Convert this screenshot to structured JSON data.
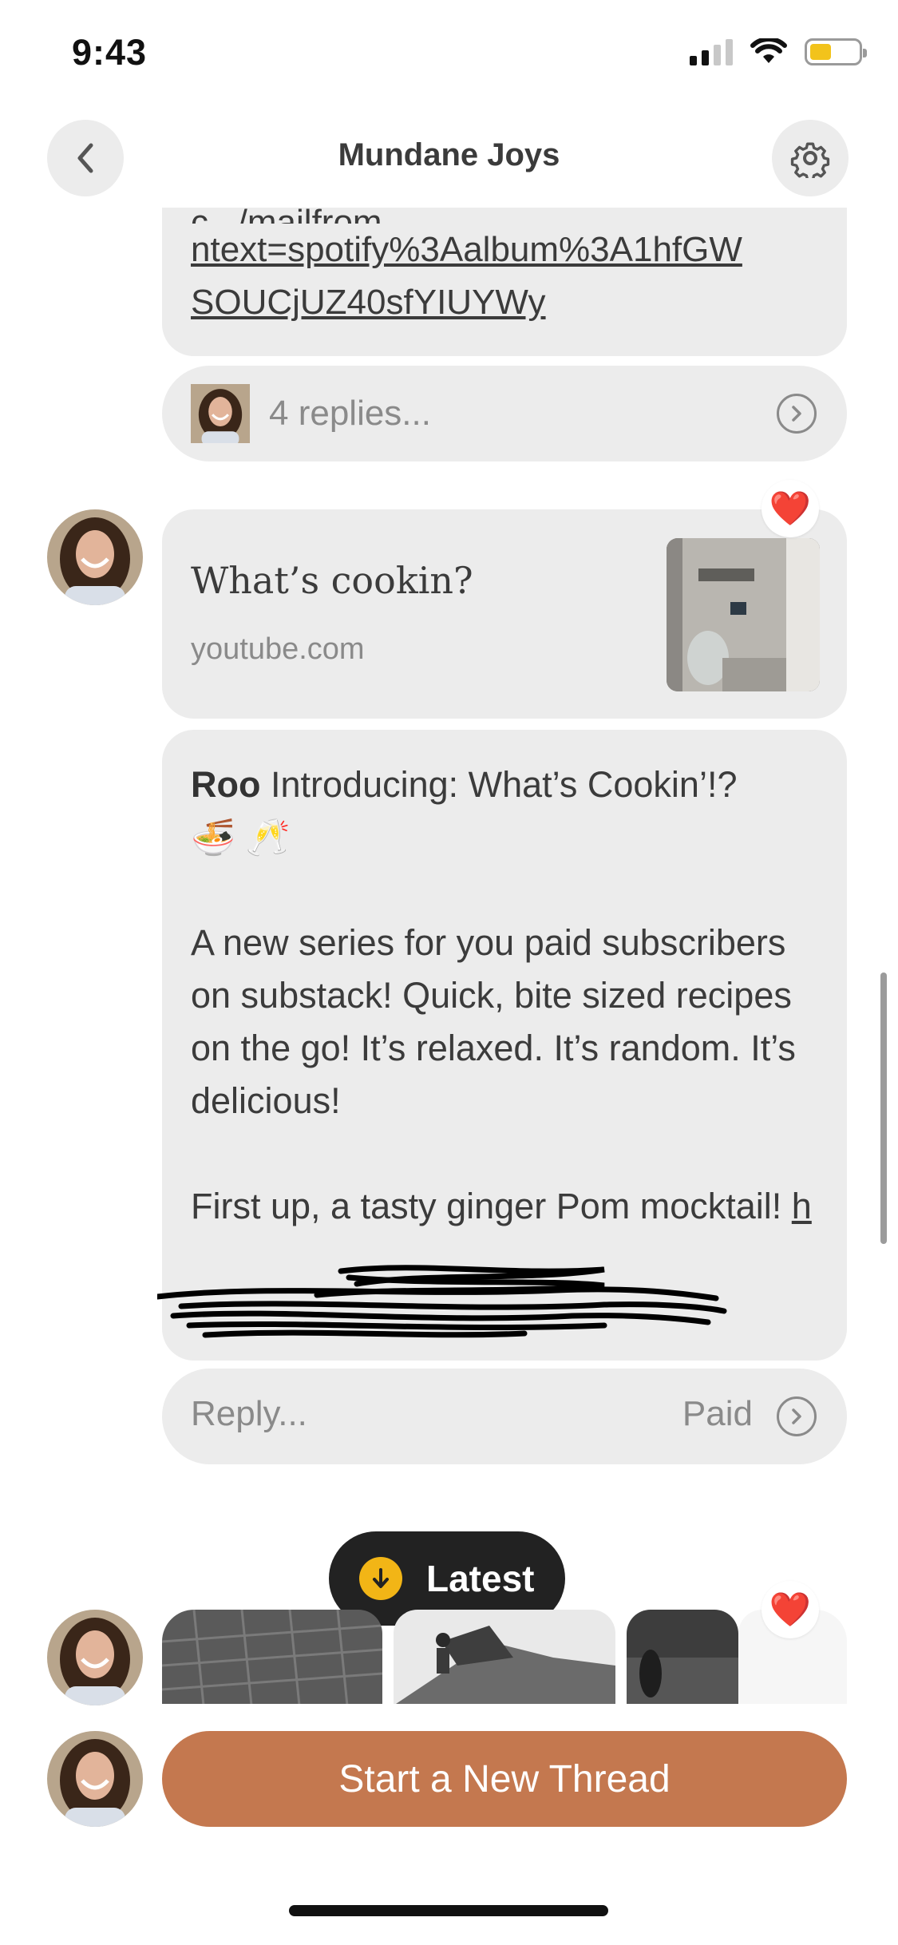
{
  "status_bar": {
    "time": "9:43"
  },
  "header": {
    "title": "Mundane Joys"
  },
  "link_message": {
    "partial_line": "c.../mailfrom...",
    "lines": [
      "ntext=spotify%3Aalbum%3A1hfGW",
      "SOUCjUZ40sfYIUYWy"
    ]
  },
  "replies": {
    "label": "4 replies..."
  },
  "embed": {
    "title": "What’s cookin?",
    "domain": "youtube.com"
  },
  "post": {
    "author": "Roo",
    "intro": "Introducing: What’s Cookin’!?",
    "emojis": "🍜 🥂",
    "body": "A new series for you paid subscribers on substack! Quick, bite sized recipes on the go! It’s relaxed. It’s random. It’s delicious!",
    "closing": "First up, a tasty ginger Pom mocktail!",
    "link_start": "h"
  },
  "reply_bar": {
    "placeholder": "Reply...",
    "badge": "Paid"
  },
  "floating": {
    "latest_label": "Latest"
  },
  "footer": {
    "new_thread_label": "Start a New Thread"
  },
  "reaction": {
    "emoji": "❤️"
  },
  "colors": {
    "accent_button": "#c4784f",
    "card_bg": "#ececec",
    "latest_dot": "#f2b516",
    "pill_bg": "#222222"
  }
}
